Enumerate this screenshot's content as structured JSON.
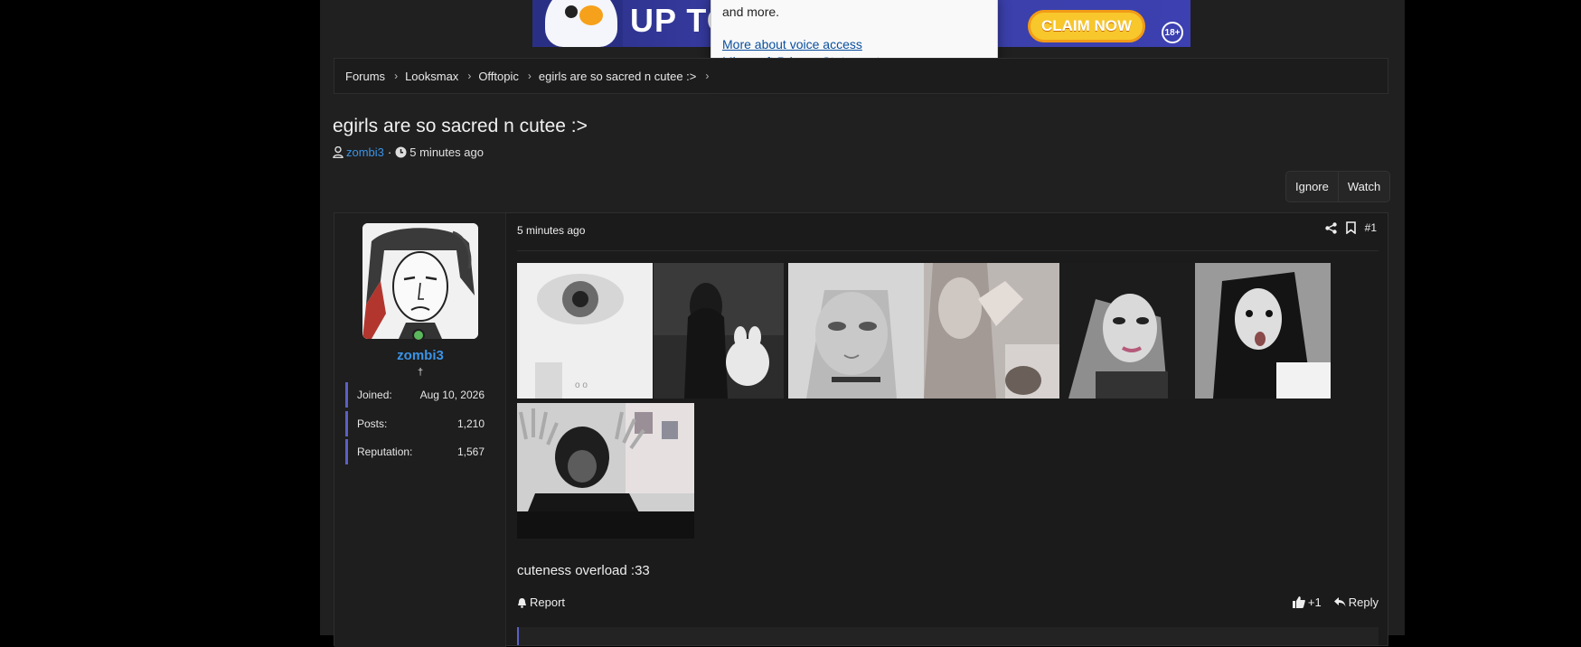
{
  "ad": {
    "headline": "UP TO",
    "claim_label": "CLAIM NOW",
    "age_badge": "18+"
  },
  "popup": {
    "text": "and more.",
    "link_voice": "More about voice access",
    "link_privacy": "Microsoft Privacy Statement"
  },
  "breadcrumb": [
    "Forums",
    "Looksmax",
    "Offtopic",
    "egirls are so sacred n cutee :>"
  ],
  "thread": {
    "title": "egirls are so sacred n cutee :>",
    "author": "zombi3",
    "separator": "·",
    "time": "5 minutes ago"
  },
  "buttons": {
    "ignore": "Ignore",
    "watch": "Watch"
  },
  "user": {
    "name": "zombi3",
    "title": "†",
    "stats": [
      {
        "label": "Joined:",
        "value": "Aug 10, 2026"
      },
      {
        "label": "Posts:",
        "value": "1,210"
      },
      {
        "label": "Reputation:",
        "value": "1,567"
      }
    ]
  },
  "post": {
    "date": "5 minutes ago",
    "number": "#1",
    "text": "cuteness overload :33",
    "report": "Report",
    "likes": "+1",
    "reply": "Reply"
  },
  "colors": {
    "accent": "#3b93e6",
    "background": "#202020",
    "online": "#5cb85c"
  }
}
